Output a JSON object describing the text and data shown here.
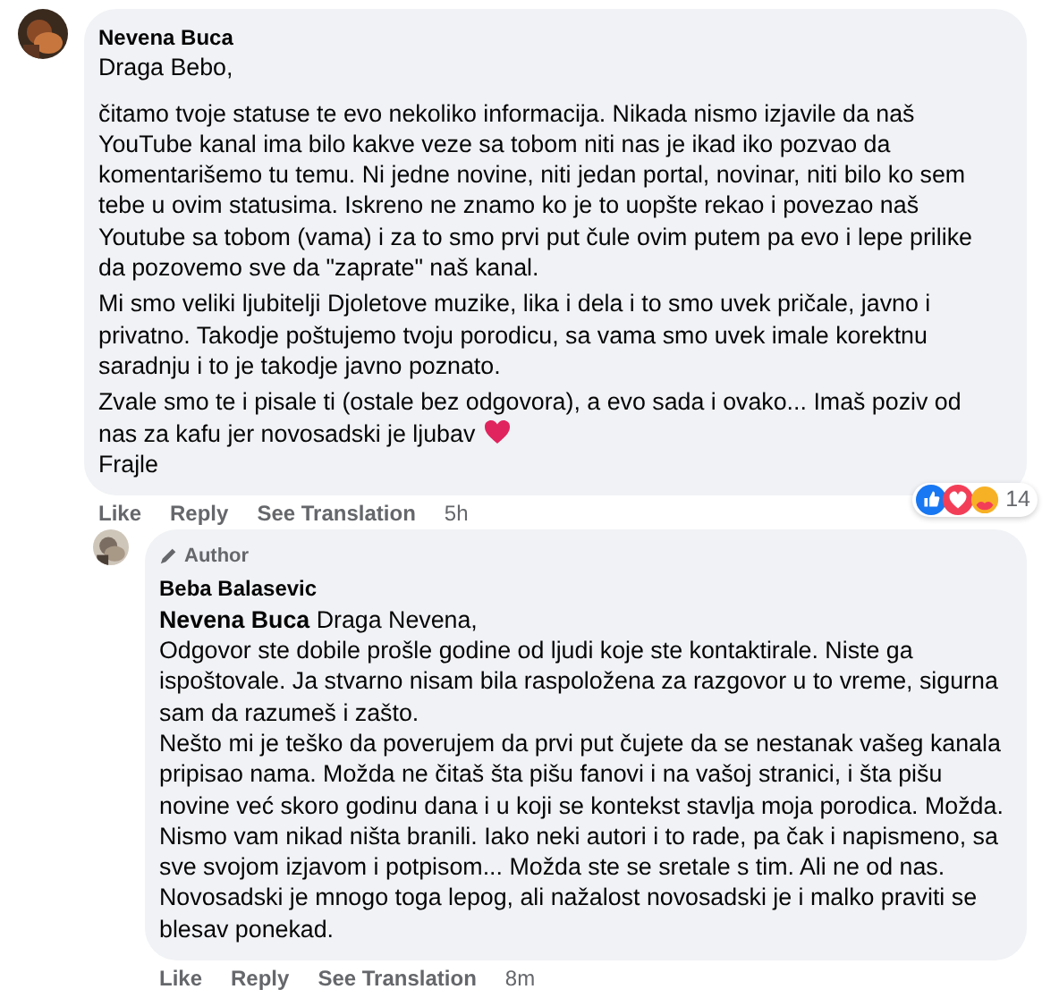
{
  "comments": [
    {
      "author": "Nevena Buca",
      "paragraphs": [
        {
          "lines": [
            "Draga Bebo,"
          ]
        },
        {
          "lines": [
            "čitamo tvoje statuse te evo nekoliko informacija. Nikada nismo izjavile da naš YouTube kanal ima bilo kakve veze sa tobom niti nas je ikad iko pozvao da komentarišemo tu temu. Ni jedne novine, niti jedan portal, novinar, niti bilo ko sem tebe u ovim statusima. Iskreno ne znamo ko je to uopšte rekao i povezao naš Youtube sa tobom (vama) i za to smo prvi put čule ovim putem pa evo i lepe prilike da pozovemo sve da \"zaprate\" naš kanal."
          ]
        },
        {
          "lines": [
            "Mi smo veliki ljubitelji Djoletove muzike, lika i dela i to smo uvek pričale, javno i privatno. Takodje poštujemo tvoju porodicu, sa vama smo uvek imale korektnu saradnju i to je takodje javno poznato."
          ]
        },
        {
          "lines": [
            "Zvale smo te i pisale ti (ostale bez odgovora), a evo sada i ovako... Imaš poziv od",
            "nas za kafu jer novosadski je ljubav"
          ],
          "heart": true,
          "after": "Frajle"
        }
      ],
      "actions": [
        "Like",
        "Reply",
        "See Translation"
      ],
      "time": "5h",
      "reactions": {
        "count": "14"
      }
    },
    {
      "author": "Beba Balasevic",
      "author_badge": "Author",
      "paragraphs": [
        {
          "lines": [
            "**Nevena Buca** Draga Nevena,",
            "Odgovor ste dobile prošle godine od ljudi koje ste kontaktirale. Niste ga ispoštovale. Ja stvarno nisam bila raspoložena za razgovor u to vreme, sigurna sam da razumeš i zašto.",
            "Nešto mi je teško da poverujem da prvi put čujete da se nestanak vašeg kanala pripisao nama. Možda ne čitaš šta pišu fanovi i na vašoj stranici, i šta pišu novine već skoro godinu dana i u koji se kontekst stavlja moja porodica. Možda.",
            "Nismo vam nikad ništa branili. Iako neki autori i to rade, pa čak i napismeno, sa sve svojom izjavom i potpisom... Možda ste se sretale s tim. Ali ne od nas.",
            "Novosadski je mnogo toga lepog, ali nažalost novosadski je i malko praviti se blesav ponekad."
          ]
        }
      ],
      "actions": [
        "Like",
        "Reply",
        "See Translation"
      ],
      "time": "8m"
    }
  ]
}
